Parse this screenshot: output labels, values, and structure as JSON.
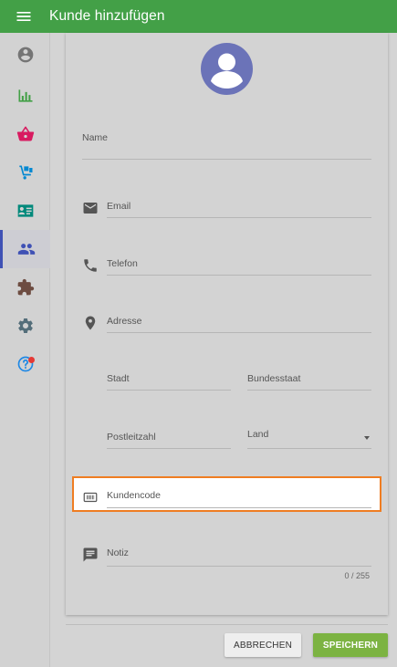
{
  "header": {
    "title": "Kunde hinzufügen",
    "menu_icon": "hamburger-menu-icon"
  },
  "sidebar": {
    "items": [
      {
        "icon": "account-circle-icon",
        "color": "#757575",
        "active": false
      },
      {
        "icon": "bar-chart-icon",
        "color": "#43a047",
        "active": false
      },
      {
        "icon": "shopping-basket-icon",
        "color": "#d81b60",
        "active": false
      },
      {
        "icon": "hand-truck-icon",
        "color": "#0288d1",
        "active": false
      },
      {
        "icon": "contact-card-icon",
        "color": "#00897b",
        "active": false
      },
      {
        "icon": "people-icon",
        "color": "#3f51b5",
        "active": true
      },
      {
        "icon": "puzzle-icon",
        "color": "#6d4c41",
        "active": false
      },
      {
        "icon": "gear-icon",
        "color": "#546e7a",
        "active": false
      },
      {
        "icon": "help-icon",
        "color": "#1e88e5",
        "active": false,
        "badge_color": "#e53935"
      }
    ]
  },
  "form": {
    "name_label": "Name",
    "email_label": "Email",
    "phone_label": "Telefon",
    "address_label": "Adresse",
    "city_label": "Stadt",
    "state_label": "Bundesstaat",
    "zip_label": "Postleitzahl",
    "country_label": "Land",
    "customer_code_label": "Kundencode",
    "note_label": "Notiz",
    "note_counter": "0 / 255"
  },
  "actions": {
    "cancel_label": "ABBRECHEN",
    "save_label": "SPEICHERN"
  },
  "colors": {
    "appbar": "#43a047",
    "highlight_border": "#ef7d22",
    "save_button": "#7cb342",
    "avatar": "#6b73b8"
  }
}
